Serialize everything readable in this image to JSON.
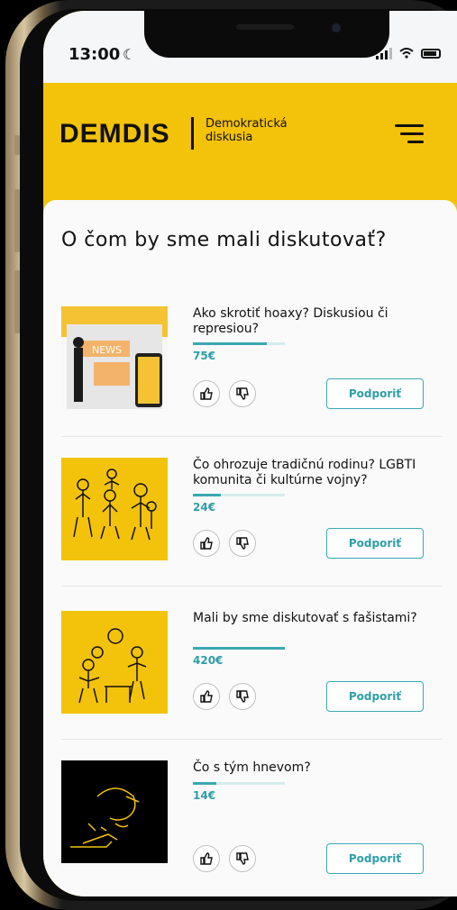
{
  "status_bar": {
    "time": "13:00",
    "moon": "☾"
  },
  "header": {
    "logo": "DEMDIS",
    "tagline_line1": "Demokratická",
    "tagline_line2": "diskusia"
  },
  "page_title": "O čom by sme mali diskutovať?",
  "topics": [
    {
      "question": "Ako skrotiť hoaxy? Diskusiou či represiou?",
      "amount": "75€",
      "progress": 0.8,
      "support_label": "Podporiť",
      "thumb_bg": "#f4c233"
    },
    {
      "question": "Čo ohrozuje tradičnú rodinu? LGBTI komunita či kultúrne vojny?",
      "amount": "24€",
      "progress": 0.3,
      "support_label": "Podporiť",
      "thumb_bg": "#f3c20a"
    },
    {
      "question": "Mali by sme diskutovať s fašistami?",
      "amount": "420€",
      "progress": 1.0,
      "support_label": "Podporiť",
      "thumb_bg": "#f3c20a"
    },
    {
      "question": "Čo s tým hnevom?",
      "amount": "14€",
      "progress": 0.25,
      "support_label": "Podporiť",
      "thumb_bg": "#000000"
    }
  ],
  "colors": {
    "brand_yellow": "#f3c20a",
    "accent_teal": "#3aa8b1"
  },
  "icons": [
    "thumbs-up-icon",
    "thumbs-down-icon",
    "hamburger-menu-icon",
    "moon-icon",
    "signal-icon",
    "wifi-icon",
    "battery-icon"
  ]
}
